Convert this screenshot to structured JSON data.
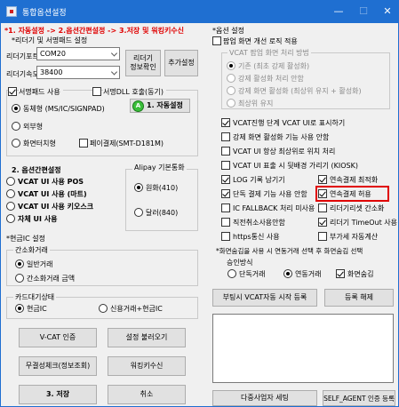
{
  "window": {
    "title": "통합옵션설정",
    "minimize": "—",
    "maximize": "☐",
    "close": "✕"
  },
  "steps_banner": "*1. 자동설정 -> 2.옵션간편설정 -> 3.저장 및 워킹키수신",
  "left": {
    "reader_section_label": "*리더기 및 서명패드 설정",
    "port_label": "리더기포트",
    "port_value": "COM20",
    "speed_label": "리더기속도",
    "speed_value": "38400",
    "reader_info_button": "리더기\n정보확인",
    "add_setting_button": "추가설정",
    "signpad_use_label": "서명패드 사용",
    "sign_dll_label": "서명DLL 호출(동기)",
    "signpad_options": [
      "동체형 (MS/IC/SIGNPAD)",
      "외부형",
      "화면터치형"
    ],
    "auto_setting_button": "1. 자동설정",
    "auto_icon": "A",
    "pay_pad_label": "페이결제(SMT-D181M)",
    "easy_setting_title": "2. 옵션간편설정",
    "easy_options": [
      "VCAT UI 사용 POS",
      "VCAT UI 사용 (마트)",
      "VCAT UI 사용 키오스크",
      "자체 UI 사용"
    ],
    "alipay_title": "Alipay 기본통화",
    "alipay_options": [
      "원화(410)",
      "달러(840)"
    ],
    "ic_title": "*현금IC 설정",
    "simple_trade_title": "간소화거래",
    "simple_trade_options": [
      "일반거래",
      "간소화거래 금액"
    ],
    "card_status_title": "카드대기상태",
    "card_status_options": [
      "현금IC",
      "신용거래+현금IC"
    ],
    "vcat_auth_button": "V-CAT 인증",
    "load_settings_button": "설정 불러오기",
    "integrity_button": "무결성체크(정보조회)",
    "working_key_button": "워킹키수신",
    "save_button": "3. 저장",
    "cancel_button": "취소"
  },
  "right": {
    "option_section_label": "*옵션 설정",
    "popup_improve_label": "팝업 화면 개선 로직 적용",
    "popup_method_title": "VCAT 팝업 화면 처리 방법",
    "popup_methods": [
      "기존 (최초 강제 활성화)",
      "강제 활성화 처리 안함",
      "강제 화면 활성화 (최상위 유지 + 활성화)",
      "최상위 유지"
    ],
    "options": [
      {
        "label": "VCAT진행 단계 VCAT UI로 표시하기",
        "checked": true
      },
      {
        "label": "강제 화면 활성화 기능 사용 안함",
        "checked": false
      },
      {
        "label": "VCAT UI 항상 최상위로 위치 처리",
        "checked": false
      },
      {
        "label": "VCAT UI 표출 시 뒷배경 가리기 (KIOSK)",
        "checked": false
      }
    ],
    "opt_rows": [
      {
        "left": "LOG 기록 남기기",
        "left_on": true,
        "right": "연속결제 최적화",
        "right_on": true
      },
      {
        "left": "단독 결제 기능 사용 안함",
        "left_on": true,
        "right": "연속결제 허용",
        "right_on": true
      },
      {
        "left": "IC FALLBACK 처리 미사용",
        "left_on": false,
        "right": "리더기리셋 간소화",
        "right_on": false
      },
      {
        "left": "직전취소사용안함",
        "left_on": false,
        "right": "리더기 TimeOut 사용",
        "right_on": true
      },
      {
        "left": "https통신 사용",
        "left_on": false,
        "right": "부가세 자동계산",
        "right_on": false
      }
    ],
    "consecutive_title": "*화면숨김을 사용 시 연동거래 선택 후 화면숨김 선택",
    "approval_method_label": "승인방식",
    "approval_options": [
      "단독거래",
      "연동거래"
    ],
    "hide_screen_label": "화면숨김",
    "boot_start_button": "부팅시 VCAT자동 시작 등록",
    "unregister_button": "등록 해제",
    "multi_business_button": "다중사업자 세팅",
    "self_agent_button": "SELF_AGENT 인증 등록"
  }
}
